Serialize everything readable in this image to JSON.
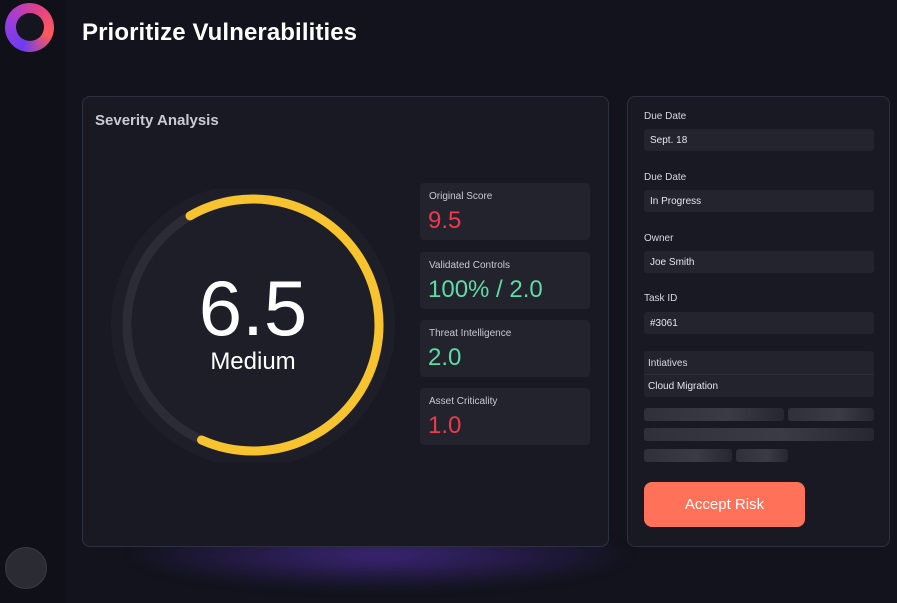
{
  "header": {
    "title": "Prioritize Vulnerabilities"
  },
  "severity": {
    "title": "Severity Analysis",
    "score": "6.5",
    "level": "Medium",
    "gauge_fraction": 0.65,
    "gauge_color": "#f7c32e"
  },
  "scores": [
    {
      "label": "Original Score",
      "value": "9.5",
      "tone": "red"
    },
    {
      "label": "Validated Controls",
      "value": "100% / 2.0",
      "tone": "green"
    },
    {
      "label": "Threat Intelligence",
      "value": "2.0",
      "tone": "green"
    },
    {
      "label": "Asset Criticality",
      "value": "1.0",
      "tone": "red"
    }
  ],
  "details": {
    "due_date_label": "Due Date",
    "due_date_value": "Sept. 18",
    "status_label": "Due Date",
    "status_value": "In Progress",
    "owner_label": "Owner",
    "owner_value": "Joe Smith",
    "task_label": "Task ID",
    "task_value": "#3061",
    "initiatives_label": "Intiatives",
    "initiatives_value": "Cloud Migration"
  },
  "actions": {
    "accept_label": "Accept Risk"
  },
  "colors": {
    "accent": "#ff7158",
    "danger": "#ee3a4c",
    "success": "#5cdca5",
    "gauge": "#f7c32e"
  },
  "icons": {
    "logo": "brand-ring-logo",
    "avatar": "user-avatar"
  }
}
